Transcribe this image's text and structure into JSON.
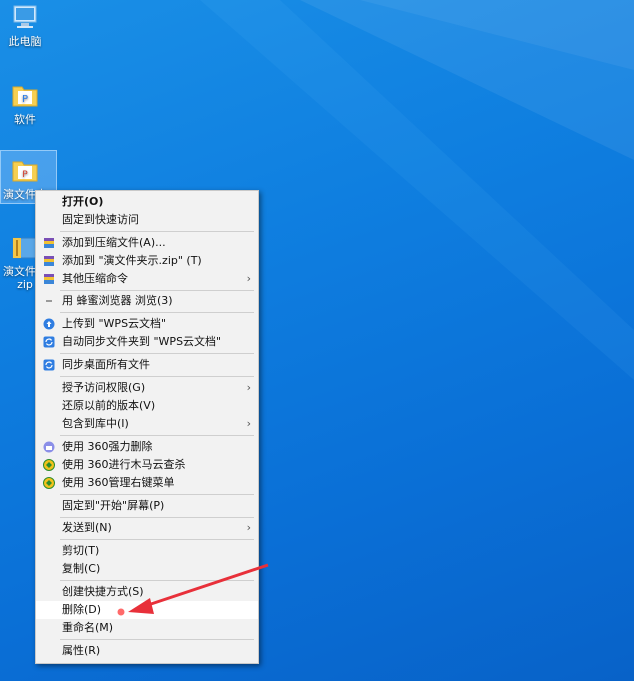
{
  "desktop": {
    "icons": [
      {
        "label": "此电脑"
      },
      {
        "label": "软件"
      },
      {
        "label": "演文件夹"
      },
      {
        "label": "演文件夹",
        "label2": "zip"
      }
    ]
  },
  "context_menu": {
    "items": [
      {
        "label": "打开(O)"
      },
      {
        "label": "固定到快速访问"
      },
      {
        "label": "添加到压缩文件(A)..."
      },
      {
        "label": "添加到 \"演文件夹示.zip\" (T)"
      },
      {
        "label": "其他压缩命令"
      },
      {
        "label": "用 蜂蜜浏览器 浏览(3)"
      },
      {
        "label": "上传到 \"WPS云文档\""
      },
      {
        "label": "自动同步文件夹到 \"WPS云文档\""
      },
      {
        "label": "同步桌面所有文件"
      },
      {
        "label": "授予访问权限(G)"
      },
      {
        "label": "还原以前的版本(V)"
      },
      {
        "label": "包含到库中(I)"
      },
      {
        "label": "使用 360强力删除"
      },
      {
        "label": "使用 360进行木马云查杀"
      },
      {
        "label": "使用 360管理右键菜单"
      },
      {
        "label": "固定到\"开始\"屏幕(P)"
      },
      {
        "label": "发送到(N)"
      },
      {
        "label": "剪切(T)"
      },
      {
        "label": "复制(C)"
      },
      {
        "label": "创建快捷方式(S)"
      },
      {
        "label": "删除(D)"
      },
      {
        "label": "重命名(M)"
      },
      {
        "label": "属性(R)"
      }
    ],
    "submenu_glyph": "›"
  },
  "colors": {
    "desktop_bg": "#0f7fe0",
    "menu_bg": "#f2f2f2",
    "annotation_arrow": "#e8303a"
  }
}
